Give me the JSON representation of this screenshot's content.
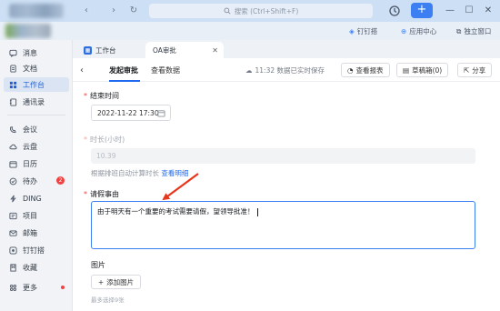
{
  "topbar": {
    "search_placeholder": "搜索 (Ctrl+Shift+F)",
    "plus_label": "+",
    "window_controls": [
      "—",
      "☐",
      "✕"
    ]
  },
  "subbar": {
    "dingding": "钉钉搭",
    "app_center": "应用中心",
    "independent": "独立窗口"
  },
  "sidebar": {
    "items": [
      {
        "label": "消息",
        "icon": "message-icon"
      },
      {
        "label": "文档",
        "icon": "document-icon"
      },
      {
        "label": "工作台",
        "icon": "workbench-icon",
        "active": true
      },
      {
        "label": "通讯录",
        "icon": "contacts-icon"
      },
      {
        "label": "会议",
        "icon": "meeting-icon"
      },
      {
        "label": "云盘",
        "icon": "cloud-icon"
      },
      {
        "label": "日历",
        "icon": "calendar-icon"
      },
      {
        "label": "待办",
        "icon": "todo-icon",
        "badge": "2"
      },
      {
        "label": "DING",
        "icon": "ding-icon"
      },
      {
        "label": "项目",
        "icon": "project-icon"
      },
      {
        "label": "邮箱",
        "icon": "mail-icon"
      },
      {
        "label": "钉钉搭",
        "icon": "dingda-icon"
      },
      {
        "label": "收藏",
        "icon": "favorite-icon"
      },
      {
        "label": "更多",
        "icon": "more-icon",
        "dot": true
      }
    ]
  },
  "tabs": [
    {
      "label": "工作台"
    },
    {
      "label": "OA审批",
      "active": true
    }
  ],
  "page": {
    "tab_initiate": "发起审批",
    "tab_data": "查看数据",
    "save_msg": "11:32 数据已实时保存",
    "btn_report": "查看报表",
    "btn_draft": "草稿箱(0)",
    "btn_share": "分享"
  },
  "form": {
    "end_time_label": "结束时间",
    "end_time_value": "2022-11-22 17:30",
    "duration_label": "时长(小时)",
    "duration_value": "10.39",
    "duration_hint": "根据排班自动计算时长",
    "duration_hint_link": "查看明细",
    "reason_label": "请假事由",
    "reason_value": "由于明天有一个重要的考试需要请假，望领导批准！",
    "image_label": "图片",
    "add_image": "添加图片",
    "image_hint": "最多选择9张"
  },
  "colors": {
    "accent": "#1f68f0",
    "annotation_arrow": "#e8361c"
  }
}
